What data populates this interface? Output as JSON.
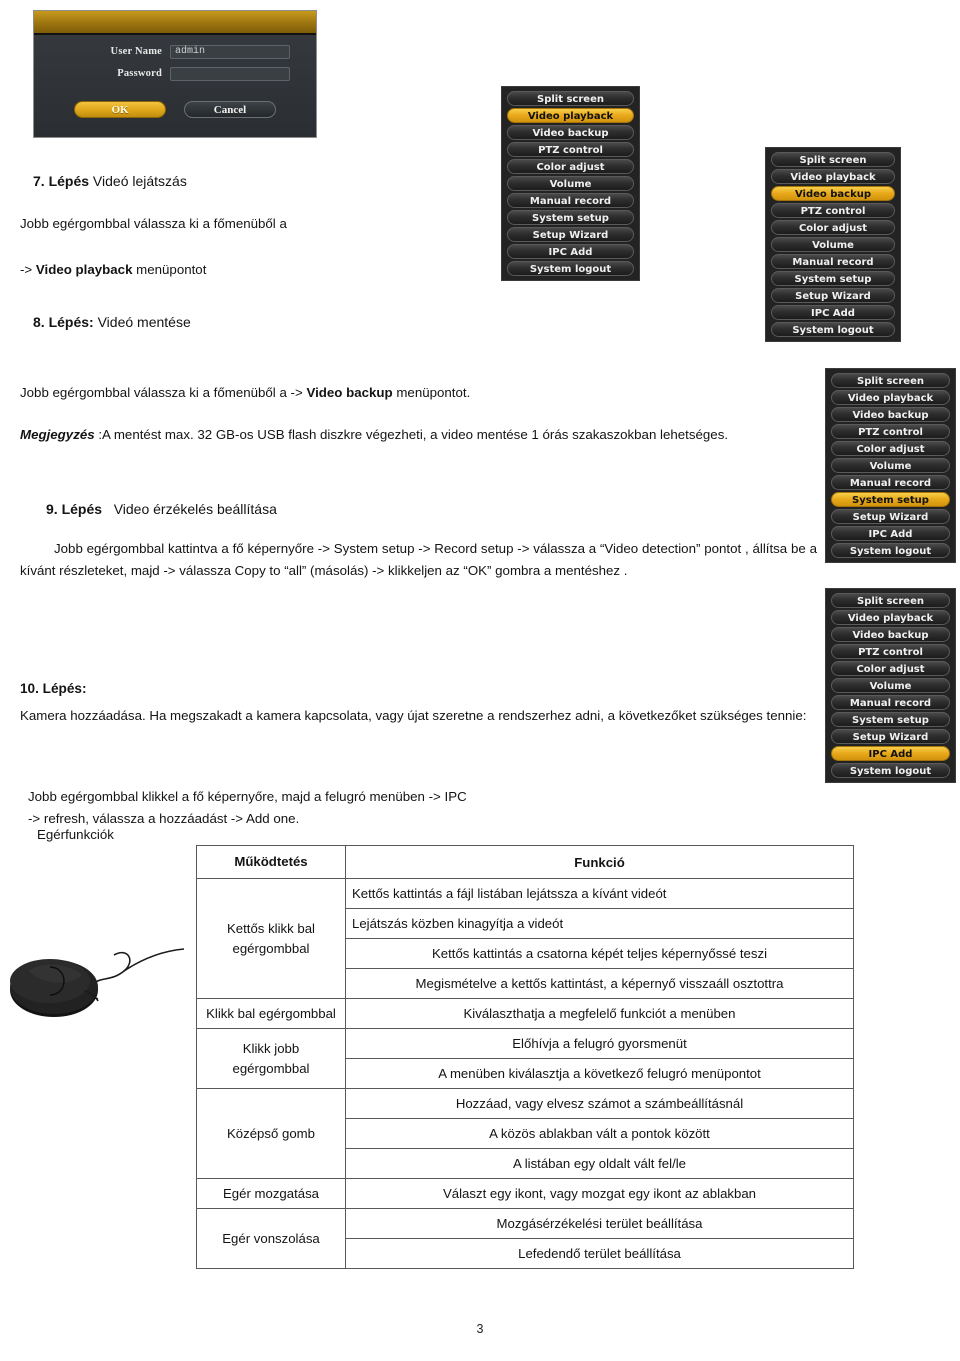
{
  "login_dialog": {
    "username_label": "User Name",
    "username_value": "admin",
    "password_label": "Password",
    "password_value": "",
    "ok_label": "OK",
    "cancel_label": "Cancel",
    "accent_color": "#e0a81c"
  },
  "dvr_menu_items": [
    "Split screen",
    "Video playback",
    "Video backup",
    "PTZ control",
    "Color adjust",
    "Volume",
    "Manual record",
    "System setup",
    "Setup Wizard",
    "IPC Add",
    "System logout"
  ],
  "menus": [
    {
      "selected": "Video playback"
    },
    {
      "selected": "Video backup"
    },
    {
      "selected": "System setup"
    },
    {
      "selected": "IPC Add"
    }
  ],
  "steps": {
    "step7": {
      "number": "7. Lépés",
      "title": "Videó lejátszás",
      "line1": "Jobb egérgombbal válassza ki a főmenüből a",
      "line2_prefix": "-> ",
      "line2_bold": "Video playback",
      "line2_suffix": " menüpontot"
    },
    "step8": {
      "number": "8. Lépés:",
      "title": "Videó mentése",
      "line1_prefix": "Jobb egérgombbal válassza ki a főmenüből a    -> ",
      "line1_bold": "Video backup",
      "line1_suffix": " menüpontot.",
      "note_label": "Megjegyzés",
      "note_text": " :A mentést max. 32 GB-os USB flash diszkre végezheti, a video mentése 1 órás szakaszokban lehetséges."
    },
    "step9": {
      "number": "9. Lépés",
      "title": "Video érzékelés beállítása",
      "body": "Jobb egérgombbal kattintva a fő képernyőre    -> System setup -> Record setup -> válassza a “Video detection” pontot , állítsa be a kívánt részleteket, majd   -> válassza   Copy to “all”   (másolás)   ->  klikkeljen   az “OK” gombra a mentéshez ."
    },
    "step10": {
      "number": "10. Lépés:",
      "line1": "Kamera hozzáadása.   Ha megszakadt a kamera kapcsolata, vagy újat szeretne a rendszerhez adni, a következőket szükséges tennie:",
      "line3": "Jobb egérgombbal klikkel a fő képernyőre, majd a felugró menüben -> IPC",
      "line4": "-> refresh,    válassza a hozzáadást -> Add one.",
      "mouse_functions_label": "Egérfunkciók"
    }
  },
  "function_table": {
    "headers": [
      "Működtetés",
      "Funkció"
    ],
    "rows": [
      {
        "operation": "Kettős klikk bal egérgombbal",
        "functions": [
          {
            "text": "Kettős kattintás a fájl listában lejátssza a kívánt videót",
            "align": "left"
          },
          {
            "text": "Lejátszás közben kinagyítja a videót",
            "align": "left"
          },
          {
            "text": "Kettős kattintás a csatorna képét teljes képernyőssé teszi",
            "align": "center"
          },
          {
            "text": "Megismételve a kettős kattintást, a képernyő visszaáll osztottra",
            "align": "center"
          }
        ]
      },
      {
        "operation": "Klikk bal egérgombbal",
        "functions": [
          {
            "text": "Kiválaszthatja a megfelelő funkciót a menüben",
            "align": "center"
          }
        ]
      },
      {
        "operation": "Klikk jobb egérgombbal",
        "functions": [
          {
            "text": "Előhívja a felugró gyorsmenüt",
            "align": "center"
          },
          {
            "text": "A menüben kiválasztja a következő felugró menüpontot",
            "align": "center"
          }
        ]
      },
      {
        "operation": "Középső gomb",
        "functions": [
          {
            "text": "Hozzáad, vagy elvesz számot a számbeállításnál",
            "align": "center"
          },
          {
            "text": "A közös ablakban vált a pontok között",
            "align": "center"
          },
          {
            "text": "A listában egy oldalt vált fel/le",
            "align": "center"
          }
        ]
      },
      {
        "operation": "Egér mozgatása",
        "functions": [
          {
            "text": "Választ egy ikont, vagy mozgat egy ikont az ablakban",
            "align": "center"
          }
        ]
      },
      {
        "operation": "Egér vonszolása",
        "functions": [
          {
            "text": "Mozgásérzékelési terület beállítása",
            "align": "center"
          },
          {
            "text": "Lefedendő terület beállítása",
            "align": "center"
          }
        ]
      }
    ]
  },
  "footer": {
    "page_number": "3"
  }
}
